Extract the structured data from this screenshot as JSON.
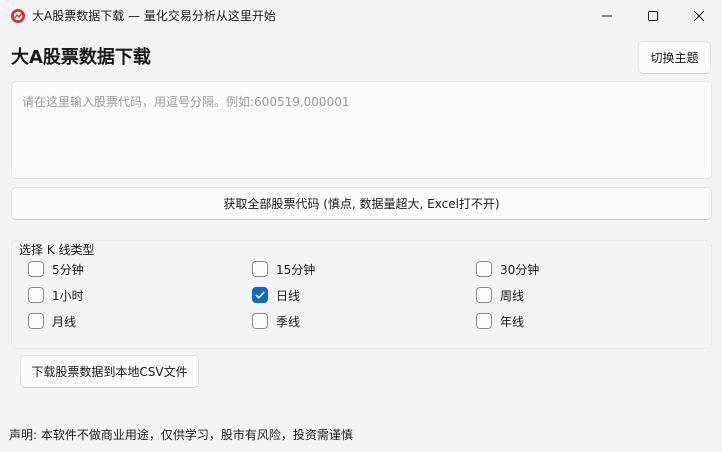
{
  "window": {
    "title": "大A股票数据下载 — 量化交易分析从这里开始",
    "app_icon": "app-logo-icon",
    "controls": {
      "minimize": "minimize-icon",
      "maximize": "maximize-icon",
      "close": "close-icon"
    }
  },
  "header": {
    "title": "大A股票数据下载",
    "theme_button": "切换主题"
  },
  "code_input": {
    "value": "",
    "placeholder": "请在这里输入股票代码，用逗号分隔。例如:600519,000001"
  },
  "fetch_all_button": "获取全部股票代码 (慎点, 数据量超大, Excel打不开)",
  "kline_group": {
    "label": "选择 K 线类型",
    "options": [
      {
        "label": "5分钟",
        "checked": false
      },
      {
        "label": "15分钟",
        "checked": false
      },
      {
        "label": "30分钟",
        "checked": false
      },
      {
        "label": "1小时",
        "checked": false
      },
      {
        "label": "日线",
        "checked": true
      },
      {
        "label": "周线",
        "checked": false
      },
      {
        "label": "月线",
        "checked": false
      },
      {
        "label": "季线",
        "checked": false
      },
      {
        "label": "年线",
        "checked": false
      }
    ]
  },
  "download_button": "下载股票数据到本地CSV文件",
  "disclaimer": "声明: 本软件不做商业用途，仅供学习，股市有风险，投资需谨慎",
  "colors": {
    "accent": "#0f6cbd",
    "background": "#f3f3f3",
    "icon_red": "#d9322e"
  }
}
